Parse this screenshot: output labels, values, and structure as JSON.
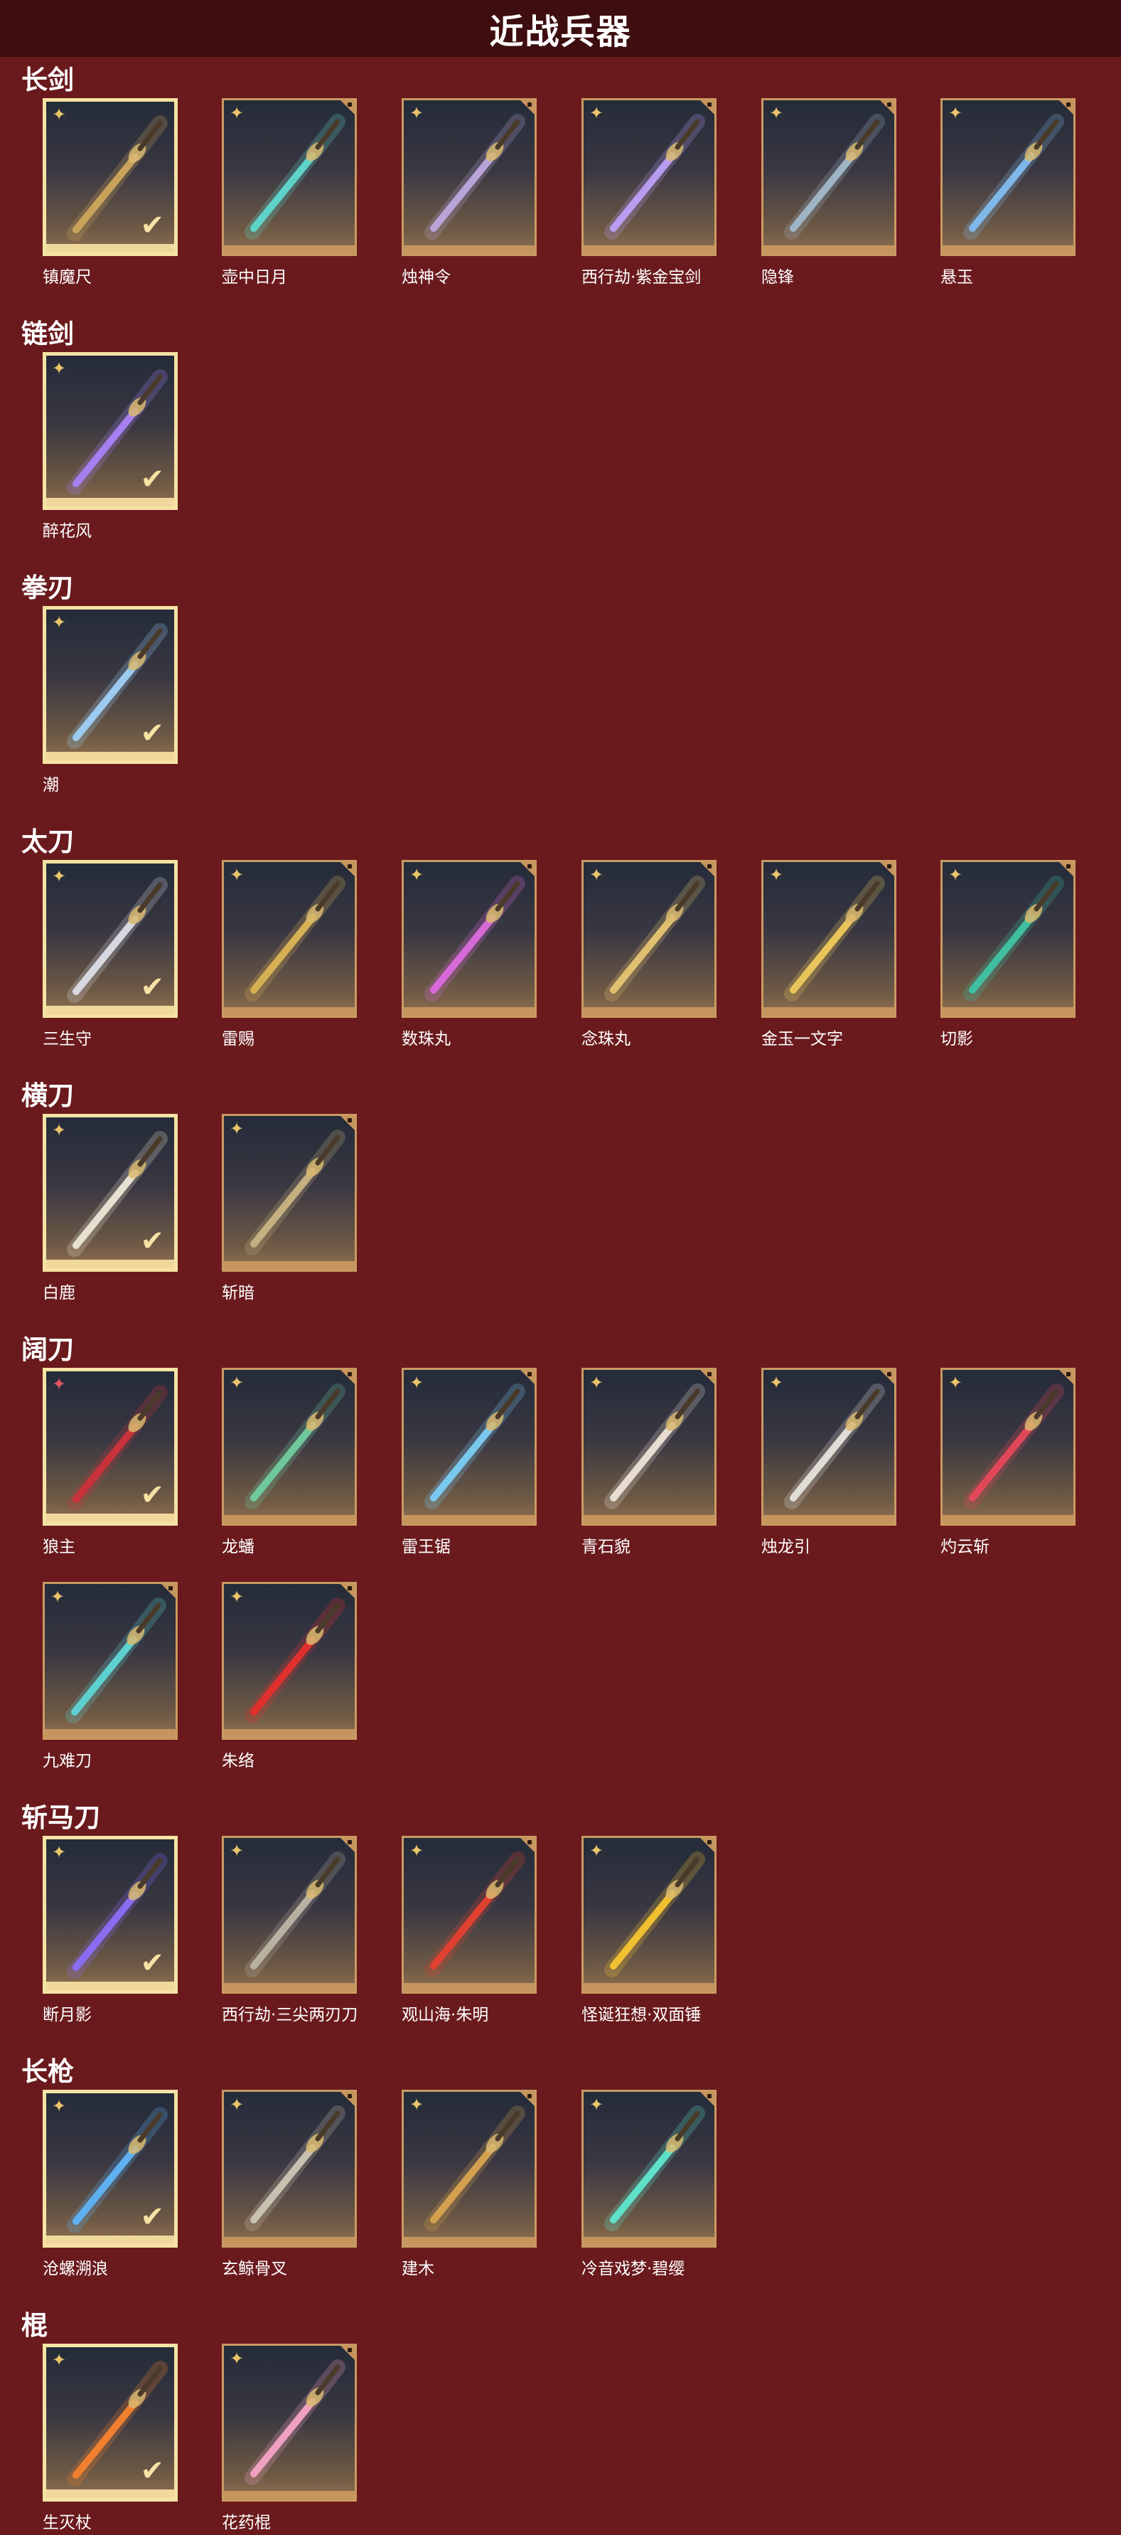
{
  "header": {
    "title": "近战兵器"
  },
  "colors": {
    "background": "#6a1a1d",
    "header": "#3e0d10",
    "frame": "#c6955e",
    "selected_frame": "#f6e3a4"
  },
  "icons": {
    "rarity": "sparkle-icon",
    "equipped": "checkmark-icon"
  },
  "categories": [
    {
      "name": "长剑",
      "items": [
        {
          "name": "镇魔尺",
          "selected": true,
          "rarity": "gold",
          "color": "#c9a35a"
        },
        {
          "name": "壶中日月",
          "selected": false,
          "rarity": "gold",
          "color": "#5fd3c9"
        },
        {
          "name": "烛神令",
          "selected": false,
          "rarity": "gold",
          "color": "#b8a4d8"
        },
        {
          "name": "西行劫·紫金宝剑",
          "selected": false,
          "rarity": "gold",
          "color": "#b79cf0"
        },
        {
          "name": "隐锋",
          "selected": false,
          "rarity": "gold",
          "color": "#9fb4c4"
        },
        {
          "name": "悬玉",
          "selected": false,
          "rarity": "gold",
          "color": "#7fb8e8"
        }
      ]
    },
    {
      "name": "链剑",
      "items": [
        {
          "name": "醉花风",
          "selected": true,
          "rarity": "gold",
          "color": "#a67ff0"
        }
      ]
    },
    {
      "name": "拳刃",
      "items": [
        {
          "name": "潮",
          "selected": true,
          "rarity": "gold",
          "color": "#9ccaf0"
        }
      ]
    },
    {
      "name": "太刀",
      "items": [
        {
          "name": "三生守",
          "selected": true,
          "rarity": "gold",
          "color": "#d8d8e0"
        },
        {
          "name": "雷赐",
          "selected": false,
          "rarity": "gold",
          "color": "#d6b054"
        },
        {
          "name": "数珠丸",
          "selected": false,
          "rarity": "gold",
          "color": "#d66ad8"
        },
        {
          "name": "念珠丸",
          "selected": false,
          "rarity": "gold",
          "color": "#e0c070"
        },
        {
          "name": "金玉一文字",
          "selected": false,
          "rarity": "gold",
          "color": "#e8c45a"
        },
        {
          "name": "切影",
          "selected": false,
          "rarity": "gold",
          "color": "#3fbfa0"
        }
      ]
    },
    {
      "name": "横刀",
      "items": [
        {
          "name": "白鹿",
          "selected": true,
          "rarity": "gold",
          "color": "#e6e0d0"
        },
        {
          "name": "斩暗",
          "selected": false,
          "rarity": "gold",
          "color": "#c4b080"
        }
      ]
    },
    {
      "name": "阔刀",
      "items": [
        {
          "name": "狼主",
          "selected": true,
          "rarity": "red",
          "color": "#c8323a"
        },
        {
          "name": "龙蟠",
          "selected": false,
          "rarity": "gold",
          "color": "#6fc89a"
        },
        {
          "name": "雷王锯",
          "selected": false,
          "rarity": "gold",
          "color": "#7ac8ee"
        },
        {
          "name": "青石貌",
          "selected": false,
          "rarity": "gold",
          "color": "#e6ddd0"
        },
        {
          "name": "烛龙引",
          "selected": false,
          "rarity": "gold",
          "color": "#e0ddd6"
        },
        {
          "name": "灼云斩",
          "selected": false,
          "rarity": "gold",
          "color": "#e0485a"
        },
        {
          "name": "九难刀",
          "selected": false,
          "rarity": "gold",
          "color": "#5fd0d0"
        },
        {
          "name": "朱络",
          "selected": false,
          "rarity": "gold",
          "color": "#e0302e"
        }
      ]
    },
    {
      "name": "斩马刀",
      "items": [
        {
          "name": "断月影",
          "selected": true,
          "rarity": "gold",
          "color": "#8a6cf0"
        },
        {
          "name": "西行劫·三尖两刃刀",
          "selected": false,
          "rarity": "gold",
          "color": "#b8b0a0"
        },
        {
          "name": "观山海·朱明",
          "selected": false,
          "rarity": "gold",
          "color": "#e04030"
        },
        {
          "name": "怪诞狂想·双面锤",
          "selected": false,
          "rarity": "gold",
          "color": "#f0c030"
        }
      ]
    },
    {
      "name": "长枪",
      "items": [
        {
          "name": "沧螺溯浪",
          "selected": true,
          "rarity": "gold",
          "color": "#5fb0f0"
        },
        {
          "name": "玄鲸骨叉",
          "selected": false,
          "rarity": "gold",
          "color": "#c8c0b0"
        },
        {
          "name": "建木",
          "selected": false,
          "rarity": "gold",
          "color": "#d4a050"
        },
        {
          "name": "冷音戏梦·碧缨",
          "selected": false,
          "rarity": "gold",
          "color": "#5fe0c8"
        }
      ]
    },
    {
      "name": "棍",
      "items": [
        {
          "name": "生灭杖",
          "selected": true,
          "rarity": "gold",
          "color": "#f08030"
        },
        {
          "name": "花药棍",
          "selected": false,
          "rarity": "gold",
          "color": "#f0a0c0"
        }
      ]
    }
  ]
}
